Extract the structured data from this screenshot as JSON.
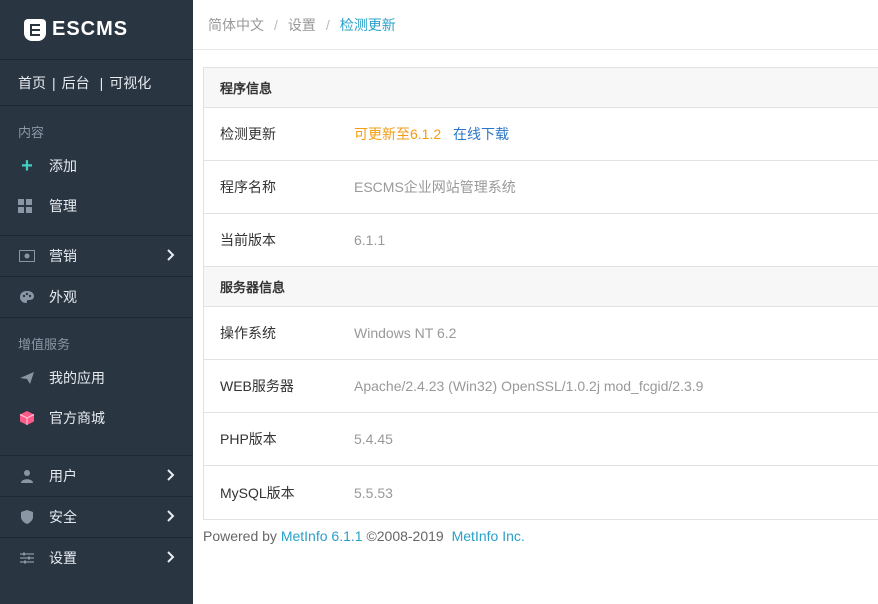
{
  "app": {
    "logo_text": "ESCMS"
  },
  "quick_links": {
    "home": "首页",
    "backend": "后台",
    "visual": "可视化",
    "sep": "|"
  },
  "sidebar": {
    "section_content": "内容",
    "add": "添加",
    "manage": "管理",
    "marketing": "营销",
    "appearance": "外观",
    "section_value": "增值服务",
    "my_apps": "我的应用",
    "store": "官方商城",
    "users": "用户",
    "security": "安全",
    "settings": "设置",
    "chevron": "›"
  },
  "breadcrumb": {
    "lang": "简体中文",
    "settings": "设置",
    "current": "检测更新",
    "sep": "/"
  },
  "program_info": {
    "title": "程序信息",
    "update_label": "检测更新",
    "update_value": "可更新至6.1.2",
    "update_link": "在线下载",
    "name_label": "程序名称",
    "name_value": "ESCMS企业网站管理系统",
    "version_label": "当前版本",
    "version_value": "6.1.1"
  },
  "server_info": {
    "title": "服务器信息",
    "os_label": "操作系统",
    "os_value": "Windows NT 6.2",
    "web_label": "WEB服务器",
    "web_value": "Apache/2.4.23 (Win32) OpenSSL/1.0.2j mod_fcgid/2.3.9",
    "php_label": "PHP版本",
    "php_value": "5.4.45",
    "mysql_label": "MySQL版本",
    "mysql_value": "5.5.53"
  },
  "footer": {
    "powered": "Powered by",
    "product": "MetInfo 6.1.1",
    "copyright": "©2008-2019",
    "company": "MetInfo Inc."
  },
  "colors": {
    "sidebar_bg": "#2a3542",
    "accent": "#2aa0c8",
    "update": "#f39c12",
    "plus": "#3fd0c1",
    "store_icon": "#ff5b8a"
  }
}
